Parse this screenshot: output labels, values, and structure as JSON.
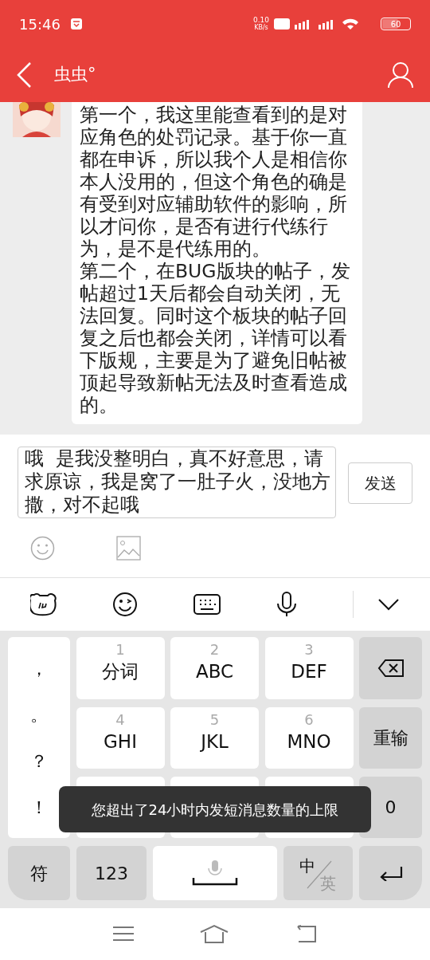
{
  "status_bar": {
    "time": "15:46",
    "speed": "0.10",
    "speed_unit": "KB/s",
    "battery": "60"
  },
  "header": {
    "title": "虫虫°"
  },
  "messages": [
    {
      "kind": "incoming",
      "paragraphs": [
        "第一个，我这里能查看到的是对应角色的处罚记录。基于你一直都在申诉，所以我个人是相信你本人没用的，但这个角色的确是有受到对应辅助软件的影响，所以才问你，是否有进行代练行为，是不是代练用的。",
        "第二个，在BUG版块的帖子，发帖超过1天后都会自动关闭，无法回复。同时这个板块的帖子回复之后也都会关闭，详情可以看下版规，主要是为了避免旧帖被顶起导致新帖无法及时查看造成的。"
      ]
    }
  ],
  "composer": {
    "value": "哦  是我没整明白，真不好意思，请求原谅，我是窝了一肚子火，没地方撒，对不起哦",
    "send": "发送"
  },
  "keyboard": {
    "left_column": [
      "，",
      "。",
      "？",
      "！"
    ],
    "keys": [
      {
        "digit": "1",
        "label": "分词"
      },
      {
        "digit": "2",
        "label": "ABC"
      },
      {
        "digit": "3",
        "label": "DEF"
      },
      {
        "digit": "4",
        "label": "GHI"
      },
      {
        "digit": "5",
        "label": "JKL"
      },
      {
        "digit": "6",
        "label": "MNO"
      },
      {
        "kind": "covered"
      },
      {
        "kind": "covered"
      },
      {
        "kind": "covered"
      }
    ],
    "right_column": [
      {
        "kind": "backspace"
      },
      {
        "kind": "text",
        "label": "重输"
      },
      {
        "kind": "text",
        "label": "0"
      }
    ],
    "bottom_row": [
      {
        "kind": "text",
        "label": "符"
      },
      {
        "kind": "text",
        "label": "123"
      },
      {
        "kind": "space"
      },
      {
        "kind": "lang",
        "top": "中",
        "bottom": "英"
      },
      {
        "kind": "enter"
      }
    ]
  },
  "toast": "您超出了24小时内发短消息数量的上限"
}
